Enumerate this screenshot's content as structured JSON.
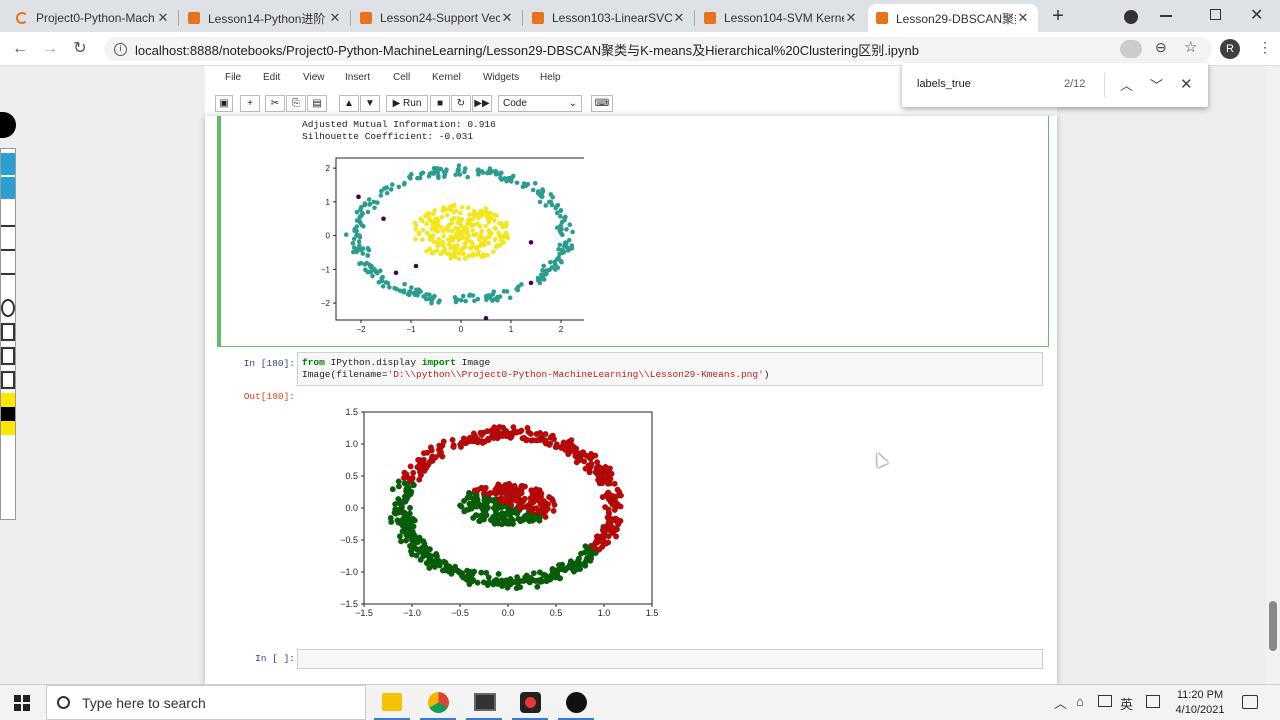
{
  "browser": {
    "tabs": [
      {
        "title": "Project0-Python-Mach",
        "close": "✕",
        "icon": "jupyter-icon"
      },
      {
        "title": "Lesson14-Python进阶",
        "close": "✕",
        "icon": "notebook-icon"
      },
      {
        "title": "Lesson24-Support Vec",
        "close": "✕",
        "icon": "notebook-icon"
      },
      {
        "title": "Lesson103-LinearSVC",
        "close": "✕",
        "icon": "notebook-icon"
      },
      {
        "title": "Lesson104-SVM Kerne",
        "close": "✕",
        "icon": "notebook-icon"
      },
      {
        "title": "Lesson29-DBSCAN聚类",
        "close": "✕",
        "icon": "notebook-icon"
      }
    ],
    "new_tab": "+",
    "url": "localhost:8888/notebooks/Project0-Python-MachineLearning/Lesson29-DBSCAN聚类与K-means及Hierarchical%20Clustering区别.ipynb",
    "profile_initial": "R",
    "accent": "#e8731a"
  },
  "find": {
    "query": "labels_true",
    "count": "2/12"
  },
  "jupyter": {
    "menu": [
      "File",
      "Edit",
      "View",
      "Insert",
      "Cell",
      "Kernel",
      "Widgets",
      "Help"
    ],
    "run_label": "Run",
    "cell_type": "Code"
  },
  "cells": {
    "output1_lines": [
      "Adjusted Mutual Information: 0.916",
      "Silhouette Coefficient: -0.031"
    ],
    "in180_prompt": "In [180]:",
    "in180_code_line1_a": "from",
    "in180_code_line1_b": " IPython.display ",
    "in180_code_line1_c": "import",
    "in180_code_line1_d": " Image",
    "in180_code_line2_a": "Image(filename=",
    "in180_code_line2_b": "'D:\\\\python\\\\Project0-Python-MachineLearning\\\\Lesson29-Kmeans.png'",
    "in180_code_line2_c": ")",
    "out180_prompt": "Out[180]:",
    "empty_prompt": "In [ ]:"
  },
  "chart_data": [
    {
      "type": "scatter",
      "title": "",
      "xlabel": "",
      "ylabel": "",
      "xlim": [
        -2.5,
        2.5
      ],
      "ylim": [
        -2.5,
        2.3
      ],
      "xticks": [
        "−2",
        "−1",
        "0",
        "1",
        "2"
      ],
      "yticks": [
        "2",
        "1",
        "0",
        "−1",
        "−2"
      ],
      "series": [
        {
          "color": "#2a9d8f",
          "shape": "ring",
          "center": [
            0,
            0
          ],
          "radius_x": 1.95,
          "radius_y": 1.95,
          "count": 300
        },
        {
          "color": "#f4e61d",
          "shape": "blob",
          "center": [
            0,
            0.1
          ],
          "radius_x": 1.0,
          "radius_y": 0.9,
          "count": 260
        },
        {
          "color": "#440154",
          "points": [
            [
              -2.05,
              1.15
            ],
            [
              -1.55,
              0.5
            ],
            [
              -0.9,
              -0.9
            ],
            [
              -1.3,
              -1.1
            ],
            [
              0.5,
              -2.45
            ],
            [
              1.4,
              -0.2
            ],
            [
              1.4,
              -1.4
            ]
          ]
        }
      ]
    },
    {
      "type": "scatter",
      "title": "",
      "xlabel": "",
      "ylabel": "",
      "xlim": [
        -1.5,
        1.5
      ],
      "ylim": [
        -1.5,
        1.5
      ],
      "xticks": [
        "−1.5",
        "−1.0",
        "−0.5",
        "0.0",
        "0.5",
        "1.0",
        "1.5"
      ],
      "yticks": [
        "1.5",
        "1.0",
        "0.5",
        "0.0",
        "−0.5",
        "−1.0",
        "−1.5"
      ],
      "series": [
        {
          "color": "#cc0000",
          "region": "outer ring, upper-left half",
          "points_approx": 300
        },
        {
          "color": "#006400",
          "region": "outer ring, lower-right half",
          "points_approx": 300
        },
        {
          "color": "#cc0000",
          "region": "inner blob, upper-left",
          "points_approx": 130
        },
        {
          "color": "#006400",
          "region": "inner blob, lower-right",
          "points_approx": 130
        }
      ]
    }
  ],
  "taskbar": {
    "search_placeholder": "Type here to search",
    "time": "11:20 PM",
    "date": "4/10/2021",
    "ime": "英"
  }
}
